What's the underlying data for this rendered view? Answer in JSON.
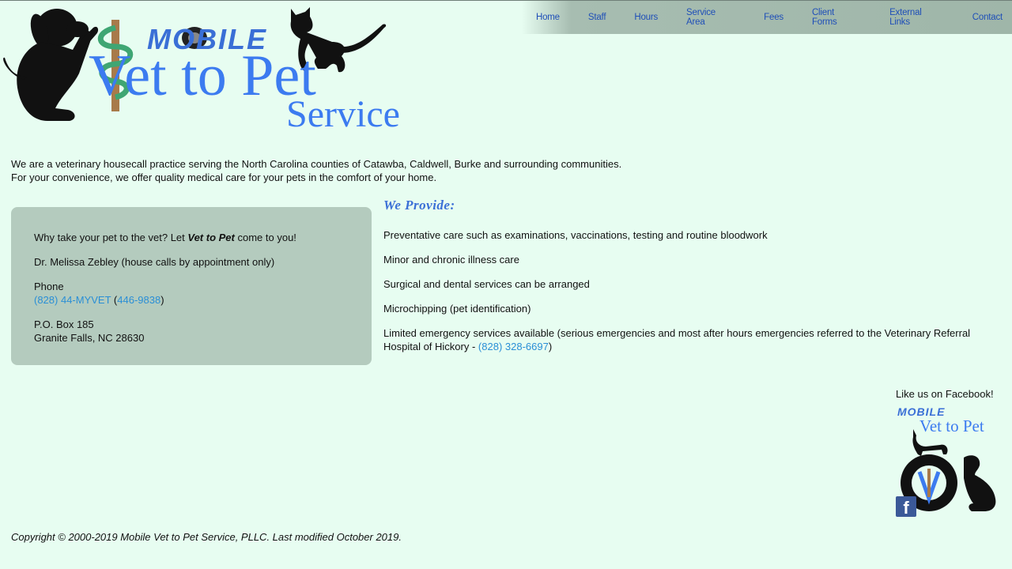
{
  "nav": {
    "items": [
      {
        "label": "Home"
      },
      {
        "label": "Staff"
      },
      {
        "label": "Hours"
      },
      {
        "label": "Service Area"
      },
      {
        "label": "Fees"
      },
      {
        "label": "Client Forms"
      },
      {
        "label": "External Links"
      },
      {
        "label": "Contact"
      }
    ]
  },
  "logo": {
    "mobile": "MOBILE",
    "name": "Vet to Pet",
    "service": "Service"
  },
  "intro": {
    "line1": "We are a veterinary housecall practice serving the North Carolina counties of Catawba, Caldwell, Burke and surrounding communities.",
    "line2": "For your convenience, we offer quality medical care for your pets in the comfort of your home."
  },
  "contact": {
    "tagline_pre": "Why take your pet to the vet? Let ",
    "tagline_brand": "Vet to Pet",
    "tagline_post": " come to you!",
    "doctor": "Dr. Melissa Zebley (house calls by appointment only)",
    "phone_label": "Phone",
    "phone_vanity": "(828) 44-MYVET",
    "phone_open": "(",
    "phone_digits": "446-9838",
    "phone_close": ")",
    "po_box": "P.O. Box 185",
    "city": "Granite Falls, NC 28630"
  },
  "provide": {
    "title": "We Provide:",
    "items": [
      "Preventative care such as examinations, vaccinations, testing and routine bloodwork",
      "Minor and chronic illness care",
      "Surgical and dental services can be arranged",
      "Microchipping (pet identification)"
    ],
    "emergency_text": "Limited emergency services available (serious emergencies and most after hours emergencies referred to the Veterinary Referral Hospital of Hickory - ",
    "emergency_phone": "(828) 328-6697",
    "emergency_close": ")"
  },
  "facebook": {
    "label": "Like us on Facebook!",
    "logo_mobile": "MOBILE",
    "logo_name": "Vet to Pet",
    "icon": "facebook-icon",
    "icon_glyph": "f"
  },
  "footer": {
    "copyright": "Copyright © 2000-2019 Mobile Vet to Pet Service, PLLC. Last modified October 2019."
  },
  "colors": {
    "background": "#e7fdf1",
    "nav_bg": "#9fb6a9",
    "nav_link": "#1f4fb8",
    "box_bg": "#b4cbbe",
    "link": "#2a8fd6",
    "logo_blue": "#3c7bf0"
  }
}
